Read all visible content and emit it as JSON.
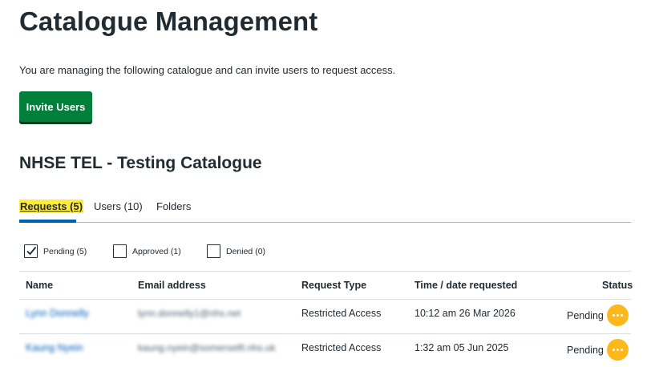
{
  "page": {
    "title": "Catalogue Management",
    "intro": "You are managing the following catalogue and can invite users to request access.",
    "invite_button": "Invite Users",
    "catalogue_name": "NHSE TEL - Testing Catalogue"
  },
  "tabs": [
    {
      "label": "Requests (5)",
      "active": true
    },
    {
      "label": "Users (10)",
      "active": false
    },
    {
      "label": "Folders",
      "active": false
    }
  ],
  "filters": [
    {
      "label": "Pending (5)",
      "checked": true
    },
    {
      "label": "Approved (1)",
      "checked": false
    },
    {
      "label": "Denied (0)",
      "checked": false
    }
  ],
  "table": {
    "headers": {
      "name": "Name",
      "email": "Email address",
      "request_type": "Request Type",
      "time": "Time / date requested",
      "status": "Status"
    },
    "rows": [
      {
        "name": "Lynn Donnelly",
        "email": "lynn.donnelly1@nhs.net",
        "request_type": "Restricted Access",
        "time": "10:12 am 26 Mar 2026",
        "status": "Pending"
      },
      {
        "name": "Kaung Nyein",
        "email": "kaung.nyein@somersetft.nhs.uk",
        "request_type": "Restricted Access",
        "time": "1:32 am 05 Jun 2025",
        "status": "Pending"
      }
    ]
  },
  "colors": {
    "button_green": "#007f3b",
    "tab_highlight": "#ffeb3b",
    "tab_underline": "#005eb8",
    "status_action": "#ffb81c",
    "link_blue": "#005eb8"
  }
}
